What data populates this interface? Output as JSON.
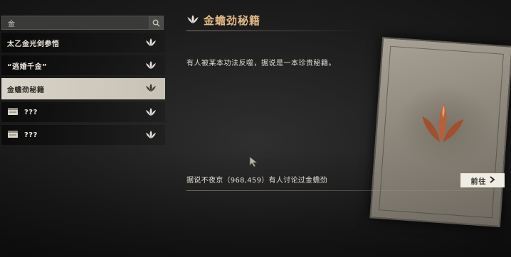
{
  "search": {
    "value": "金"
  },
  "list": {
    "items": [
      {
        "label": "太乙金光剑参悟",
        "locked": false,
        "selected": false
      },
      {
        "label": "“逃婚千金”",
        "locked": false,
        "selected": false
      },
      {
        "label": "金蟾劲秘籍",
        "locked": false,
        "selected": true
      },
      {
        "label": "???",
        "locked": true,
        "selected": false
      },
      {
        "label": "???",
        "locked": true,
        "selected": false
      }
    ]
  },
  "detail": {
    "title": "金蟾劲秘籍",
    "description": "有人被某本功法反噬，据说是一本珍贵秘籍。",
    "footer": "据说不夜京（968,459）有人讨论过金蟾劲",
    "goto_label": "前往"
  },
  "colors": {
    "title": "#e3ba84",
    "selected_row": "#d8d3c8",
    "emblem": "#b5603a"
  }
}
